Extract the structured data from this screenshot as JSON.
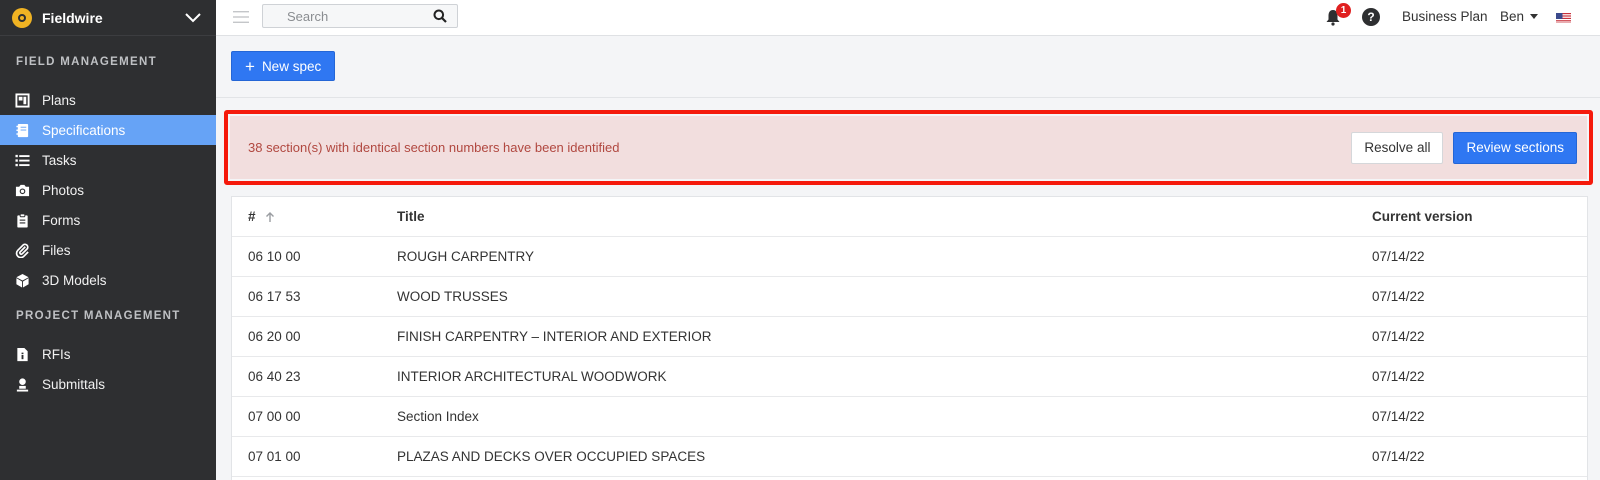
{
  "brand": {
    "name": "Fieldwire"
  },
  "sidebar": {
    "sections": [
      {
        "heading": "FIELD MANAGEMENT",
        "items": [
          {
            "label": "Plans",
            "icon": "plans-icon",
            "active": false
          },
          {
            "label": "Specifications",
            "icon": "specifications-icon",
            "active": true
          },
          {
            "label": "Tasks",
            "icon": "tasks-icon",
            "active": false
          },
          {
            "label": "Photos",
            "icon": "camera-icon",
            "active": false
          },
          {
            "label": "Forms",
            "icon": "clipboard-icon",
            "active": false
          },
          {
            "label": "Files",
            "icon": "paperclip-icon",
            "active": false
          },
          {
            "label": "3D Models",
            "icon": "cube-icon",
            "active": false
          }
        ]
      },
      {
        "heading": "PROJECT MANAGEMENT",
        "items": [
          {
            "label": "RFIs",
            "icon": "rfi-icon",
            "active": false
          },
          {
            "label": "Submittals",
            "icon": "submittals-icon",
            "active": false
          }
        ]
      }
    ]
  },
  "topbar": {
    "search_placeholder": "Search",
    "notification_count": "1",
    "help_symbol": "?",
    "plan_label": "Business Plan",
    "user_name": "Ben"
  },
  "toolbar": {
    "new_spec_label": "New spec"
  },
  "alert": {
    "message": "38 section(s) with identical section numbers have been identified",
    "resolve_all_label": "Resolve all",
    "review_sections_label": "Review sections"
  },
  "table": {
    "columns": [
      "#",
      "Title",
      "Current version"
    ],
    "rows": [
      {
        "number": "06 10 00",
        "title": "ROUGH CARPENTRY",
        "version": "07/14/22"
      },
      {
        "number": "06 17 53",
        "title": "WOOD TRUSSES",
        "version": "07/14/22"
      },
      {
        "number": "06 20 00",
        "title": "FINISH CARPENTRY – INTERIOR AND EXTERIOR",
        "version": "07/14/22"
      },
      {
        "number": "06 40 23",
        "title": "INTERIOR ARCHITECTURAL WOODWORK",
        "version": "07/14/22"
      },
      {
        "number": "07 00 00",
        "title": "Section Index",
        "version": "07/14/22"
      },
      {
        "number": "07 01 00",
        "title": "PLAZAS AND DECKS OVER OCCUPIED SPACES",
        "version": "07/14/22"
      }
    ]
  },
  "colors": {
    "sidebar_bg": "#2e2f31",
    "active_item": "#66a3f6",
    "primary_button": "#2f77f2",
    "alert_bg": "#f2dede",
    "alert_text": "#b14840",
    "highlight_outline": "#f51a0c",
    "badge": "#e02020"
  }
}
